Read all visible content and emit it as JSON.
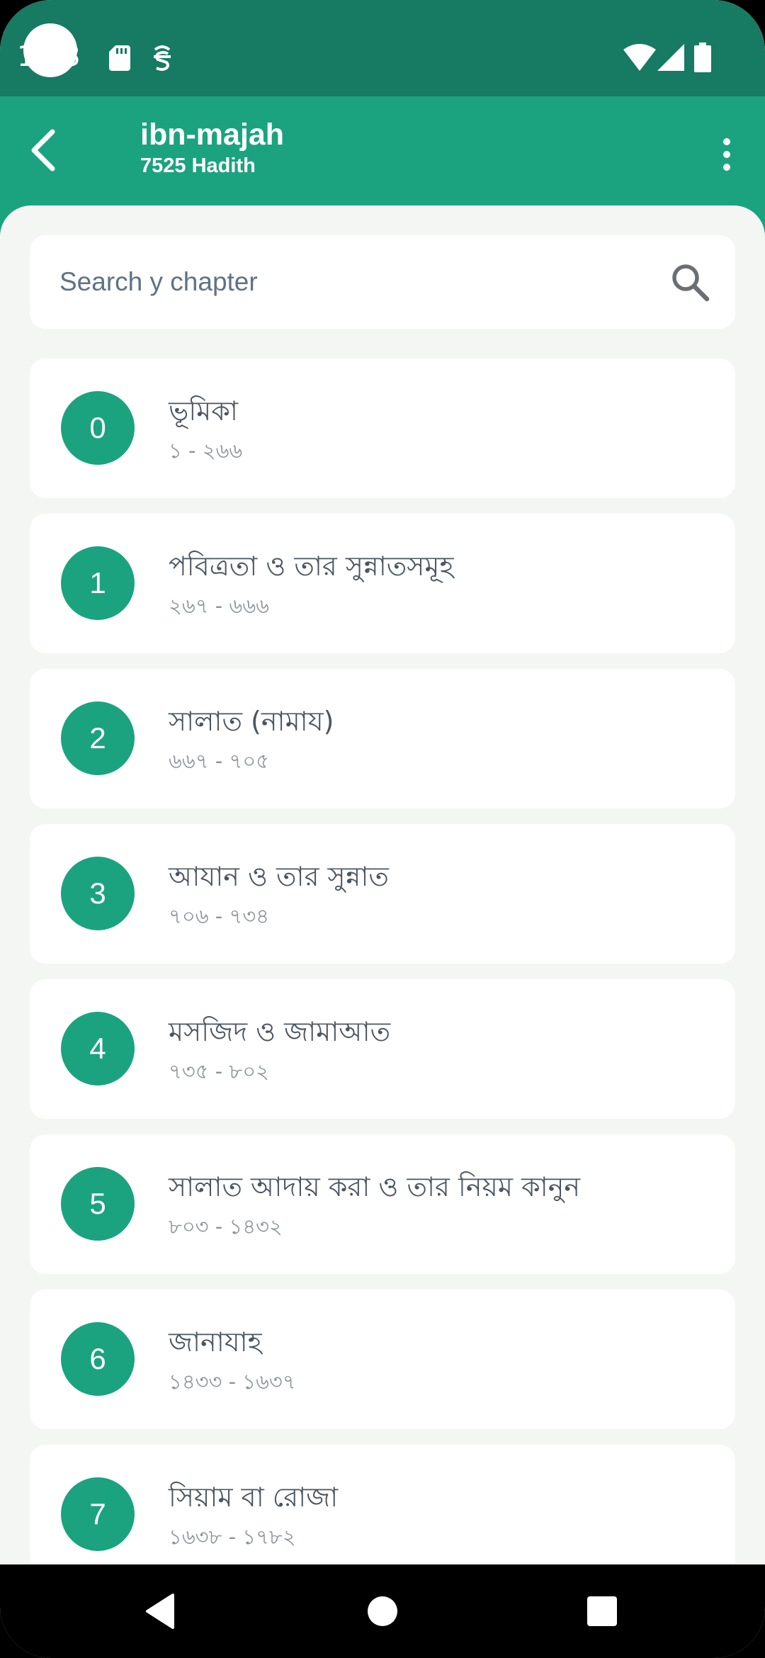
{
  "status_bar": {
    "time": "1:33",
    "icons": [
      "sd-card-icon",
      "pocket-sync-icon",
      "wifi-icon",
      "cell-signal-icon",
      "battery-icon"
    ]
  },
  "app_bar": {
    "title": "ibn-majah",
    "subtitle": "7525 Hadith",
    "back_icon": "chevron-left-icon",
    "menu_icon": "more-vertical-icon"
  },
  "search": {
    "placeholder": "Search y chapter",
    "icon": "search-icon"
  },
  "chapters": [
    {
      "number": "0",
      "title": "ভূমিকা",
      "range": "১ - ২৬৬"
    },
    {
      "number": "1",
      "title": "পবিত্রতা ও তার সুন্নাতসমূহ",
      "range": "২৬৭ - ৬৬৬"
    },
    {
      "number": "2",
      "title": "সালাত (নামায)",
      "range": "৬৬৭ - ৭০৫"
    },
    {
      "number": "3",
      "title": "আযান ও তার সুন্নাত",
      "range": "৭০৬ - ৭৩৪"
    },
    {
      "number": "4",
      "title": "মসজিদ ও জামাআত",
      "range": "৭৩৫ - ৮০২"
    },
    {
      "number": "5",
      "title": "সালাত আদায় করা ও তার নিয়ম কানুন",
      "range": "৮০৩ - ১৪৩২"
    },
    {
      "number": "6",
      "title": "জানাযাহ",
      "range": "১৪৩৩ - ১৬৩৭"
    },
    {
      "number": "7",
      "title": "সিয়াম বা রোজা",
      "range": "১৬৩৮ - ১৭৮২"
    }
  ],
  "nav_bar": {
    "icons": [
      "nav-back-icon",
      "nav-home-icon",
      "nav-recents-icon"
    ]
  },
  "colors": {
    "status_bar": "#177a63",
    "app_bar": "#1ba380",
    "accent": "#1ba380",
    "background": "#f4f6f3",
    "card": "#ffffff"
  }
}
